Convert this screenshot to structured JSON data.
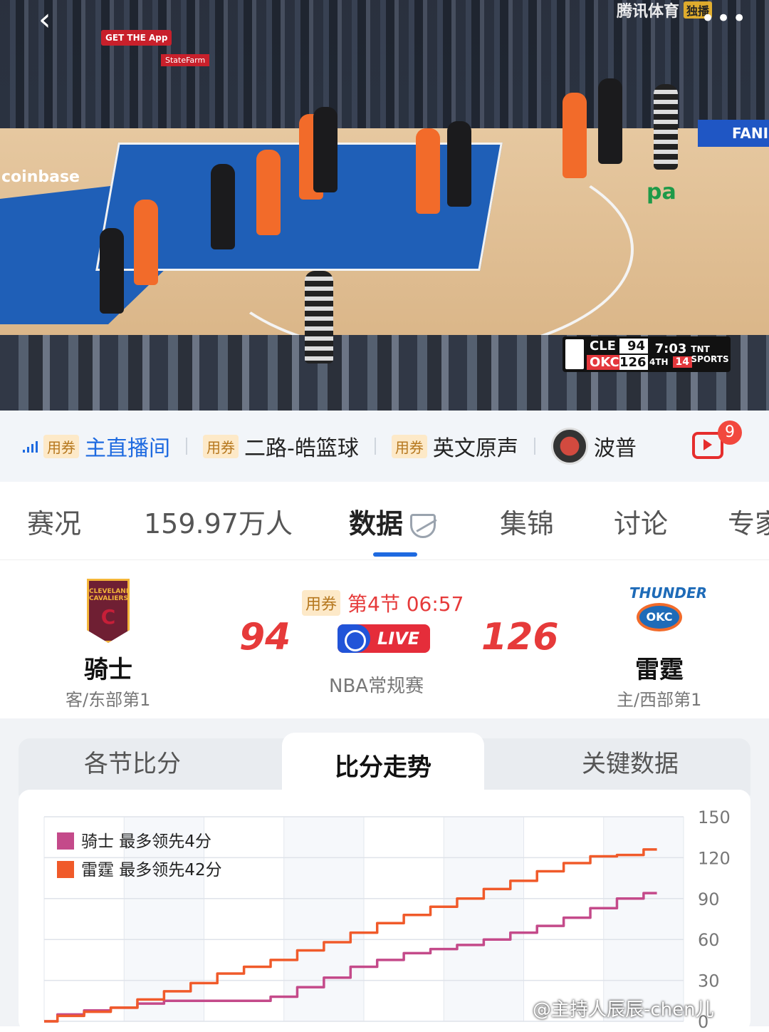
{
  "video": {
    "brand": "腾讯体育",
    "brand_badge": "独播",
    "arena_signs": {
      "coinbase": "coinbase",
      "getapp": "GET THE App",
      "statefarm": "StateFarm",
      "fan": "FANI",
      "paycom": "pa"
    },
    "score_bug": {
      "away_abbr": "CLE",
      "away_score": "94",
      "home_abbr": "OKC",
      "home_score": "126",
      "clock": "7:03",
      "period": "4TH",
      "timeouts": "14",
      "network": "TNT SPORTS"
    }
  },
  "sources": [
    {
      "coupon": "用券",
      "label": "主直播间",
      "active": true
    },
    {
      "coupon": "用券",
      "label": "二路-皓篮球",
      "active": false
    },
    {
      "coupon": "用券",
      "label": "英文原声",
      "active": false
    },
    {
      "label": "波普",
      "active": false
    }
  ],
  "tv_badge": "9",
  "tabs": [
    {
      "label": "赛况"
    },
    {
      "label": "159.97万人"
    },
    {
      "label": "数据",
      "active": true
    },
    {
      "label": "集锦"
    },
    {
      "label": "讨论"
    },
    {
      "label": "专家"
    }
  ],
  "match": {
    "coupon": "用券",
    "status": "第4节 06:57",
    "live_label": "LIVE",
    "league": "NBA常规赛",
    "away": {
      "name": "骑士",
      "sub": "客/东部第1",
      "score": "94",
      "logo_text": "CLEVELAND CAVALIERS",
      "logo_letter": "C"
    },
    "home": {
      "name": "雷霆",
      "sub": "主/西部第1",
      "score": "126",
      "logo_text": "THUNDER",
      "logo_ball": "OKC"
    }
  },
  "chart_tabs": [
    {
      "label": "各节比分"
    },
    {
      "label": "比分走势",
      "active": true
    },
    {
      "label": "关键数据"
    }
  ],
  "chart_data": {
    "type": "line",
    "ylim": [
      0,
      150
    ],
    "yticks": [
      0,
      30,
      60,
      90,
      120,
      150
    ],
    "xlim": [
      0,
      48
    ],
    "grid": true,
    "legend_placement": "top-left",
    "series": [
      {
        "name": "骑士",
        "legend_text": "骑士  最多领先4分",
        "color": "#c44a8a",
        "x": [
          0,
          2,
          4,
          6,
          8,
          10,
          12,
          14,
          16,
          18,
          20,
          22,
          24,
          26,
          28,
          30,
          32,
          34,
          36,
          38,
          40,
          42,
          44,
          46
        ],
        "y": [
          0,
          5,
          8,
          10,
          13,
          15,
          15,
          15,
          15,
          18,
          25,
          32,
          40,
          45,
          50,
          53,
          56,
          60,
          65,
          70,
          76,
          83,
          90,
          94
        ]
      },
      {
        "name": "雷霆",
        "legend_text": "雷霆  最多领先42分",
        "color": "#f05a2a",
        "x": [
          0,
          2,
          4,
          6,
          8,
          10,
          12,
          14,
          16,
          18,
          20,
          22,
          24,
          26,
          28,
          30,
          32,
          34,
          36,
          38,
          40,
          42,
          44,
          46
        ],
        "y": [
          0,
          4,
          7,
          10,
          16,
          22,
          28,
          35,
          40,
          45,
          52,
          58,
          65,
          72,
          78,
          84,
          90,
          97,
          103,
          110,
          116,
          121,
          122,
          126
        ]
      }
    ]
  },
  "watermark": "@主持人辰辰-chen儿"
}
